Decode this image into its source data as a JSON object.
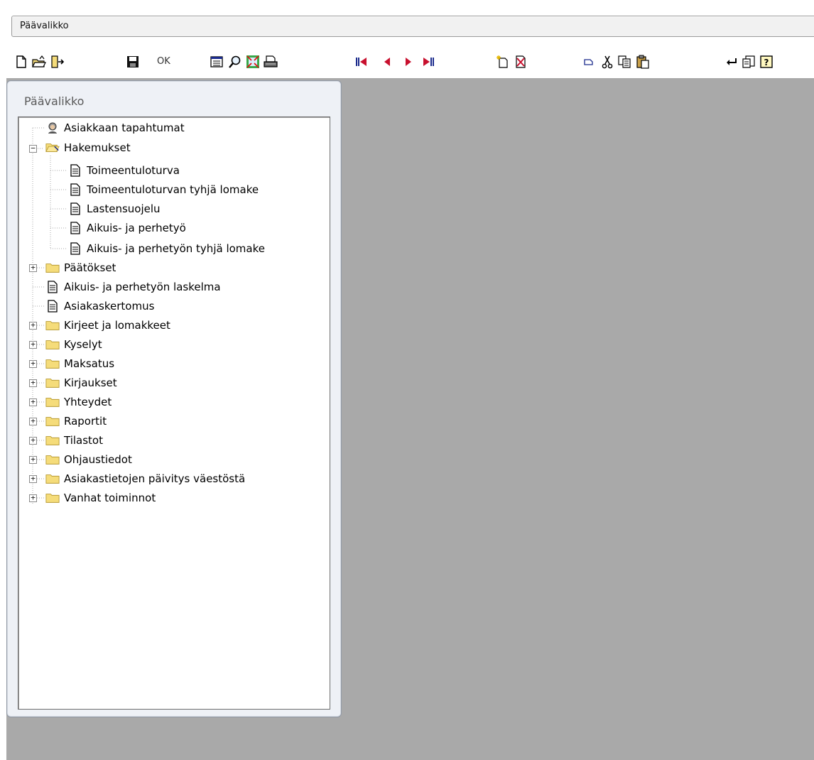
{
  "window": {
    "title": "Päävalikko"
  },
  "toolbar": {
    "ok_label": "OK",
    "buttons": [
      "new-icon",
      "open-icon",
      "exit-icon",
      "save-icon",
      "form-icon",
      "search-icon",
      "zoom-icon",
      "print-icon",
      "first-record-icon",
      "previous-record-icon",
      "next-record-icon",
      "last-record-icon",
      "new-record-icon",
      "delete-record-icon",
      "select-icon",
      "cut-icon",
      "copy-icon",
      "paste-icon",
      "back-icon",
      "notes-icon",
      "help-icon"
    ]
  },
  "panel": {
    "title": "Päävalikko"
  },
  "tree": {
    "asiakkaan_tapahtumat": "Asiakkaan tapahtumat",
    "hakemukset": "Hakemukset",
    "toimeentuloturva": "Toimeentuloturva",
    "toimeentuloturvan_tyhja": "Toimeentuloturvan tyhjä lomake",
    "lastensuojelu": "Lastensuojelu",
    "aikuis_perhetyo": "Aikuis- ja perhetyö",
    "aikuis_perhetyon_tyhja": "Aikuis- ja perhetyön tyhjä lomake",
    "paatokset": "Päätökset",
    "aikuis_laskelma": "Aikuis- ja perhetyön laskelma",
    "asiakaskertomus": "Asiakaskertomus",
    "kirjeet": "Kirjeet ja lomakkeet",
    "kyselyt": "Kyselyt",
    "maksatus": "Maksatus",
    "kirjaukset": "Kirjaukset",
    "yhteydet": "Yhteydet",
    "raportit": "Raportit",
    "tilastot": "Tilastot",
    "ohjaustiedot": "Ohjaustiedot",
    "paivitys": "Asiakastietojen päivitys väestöstä",
    "vanhat": "Vanhat toiminnot"
  },
  "colors": {
    "workspace": "#a9a9a9",
    "folder": "#f5dc7a",
    "nav_red": "#c8102e",
    "nav_blue": "#1a2a8c"
  }
}
